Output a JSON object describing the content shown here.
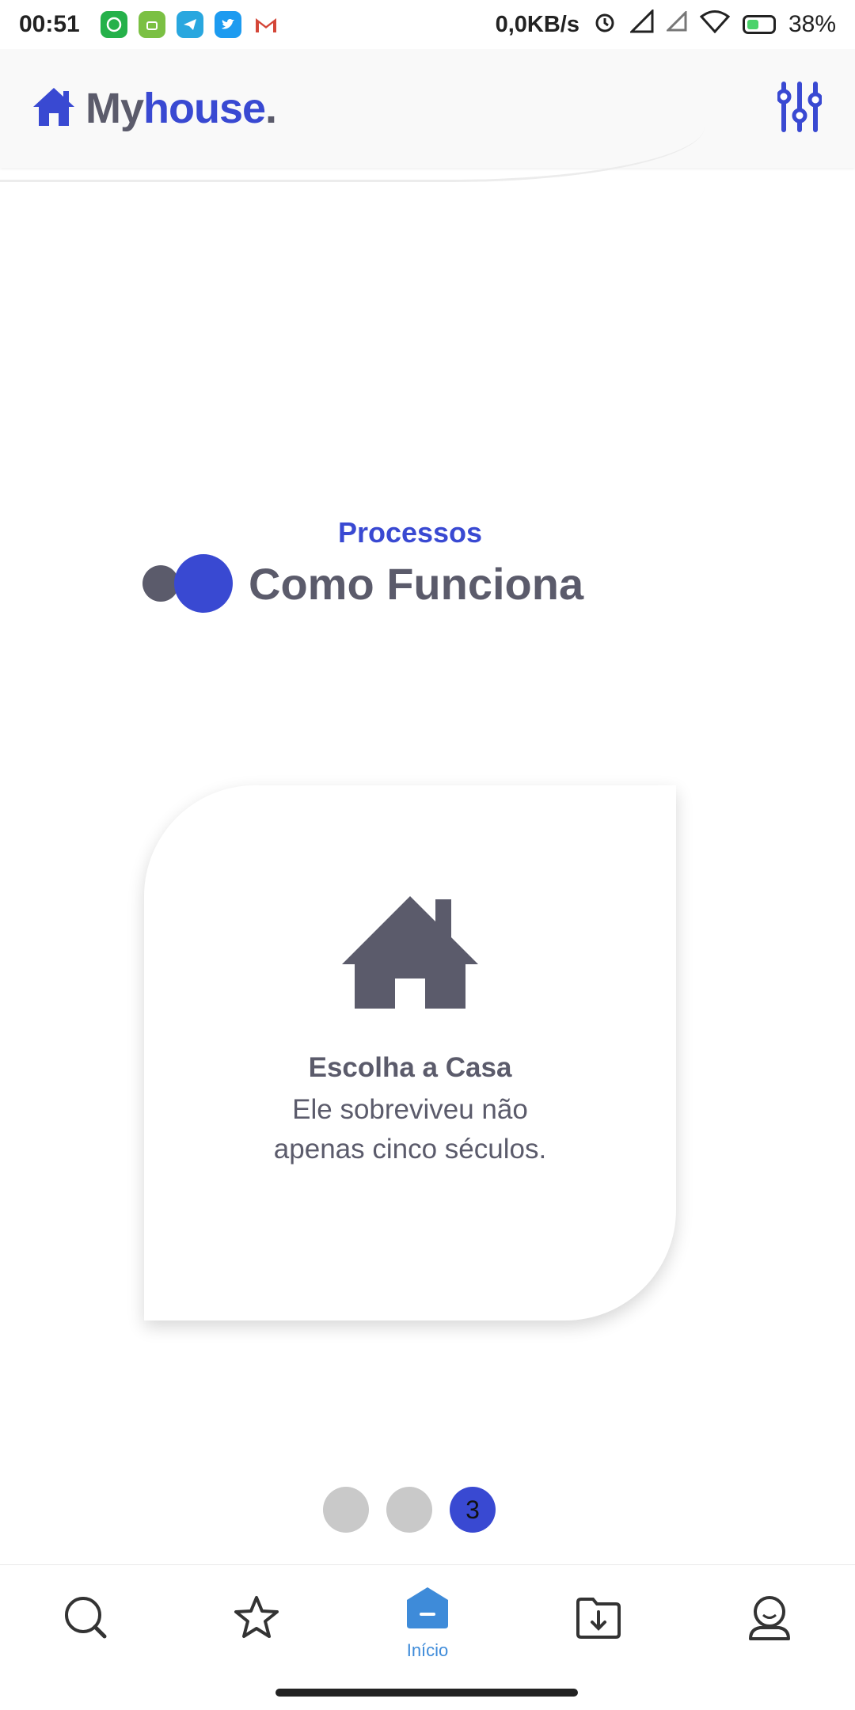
{
  "status_bar": {
    "time": "00:51",
    "app_icons": [
      {
        "name": "whatsapp-icon",
        "color": "#25b14a"
      },
      {
        "name": "android-icon",
        "color": "#7bc043"
      },
      {
        "name": "telegram-icon",
        "color": "#29a7df"
      },
      {
        "name": "twitter-icon",
        "color": "#1d9bf0"
      },
      {
        "name": "gmail-icon",
        "color": "#d44638"
      }
    ],
    "network_speed": "0,0KB/s",
    "battery": "38%"
  },
  "header": {
    "brand_my": "My",
    "brand_house": "house",
    "brand_dot": ".",
    "accent_color": "#3949d2"
  },
  "section": {
    "kicker": "Processos",
    "title": "Como Funciona"
  },
  "card": {
    "icon": "house-icon",
    "title": "Escolha a Casa",
    "description": "Ele sobreviveu não apenas cinco séculos."
  },
  "pager": {
    "dots": [
      "",
      "",
      "3"
    ],
    "active_index": 2
  },
  "bottom_nav": {
    "items": [
      {
        "name": "search-icon"
      },
      {
        "name": "star-icon"
      },
      {
        "name": "home-icon",
        "label": "Início",
        "active": true
      },
      {
        "name": "download-folder-icon"
      },
      {
        "name": "profile-icon"
      }
    ],
    "active_color": "#3e8bd9"
  }
}
